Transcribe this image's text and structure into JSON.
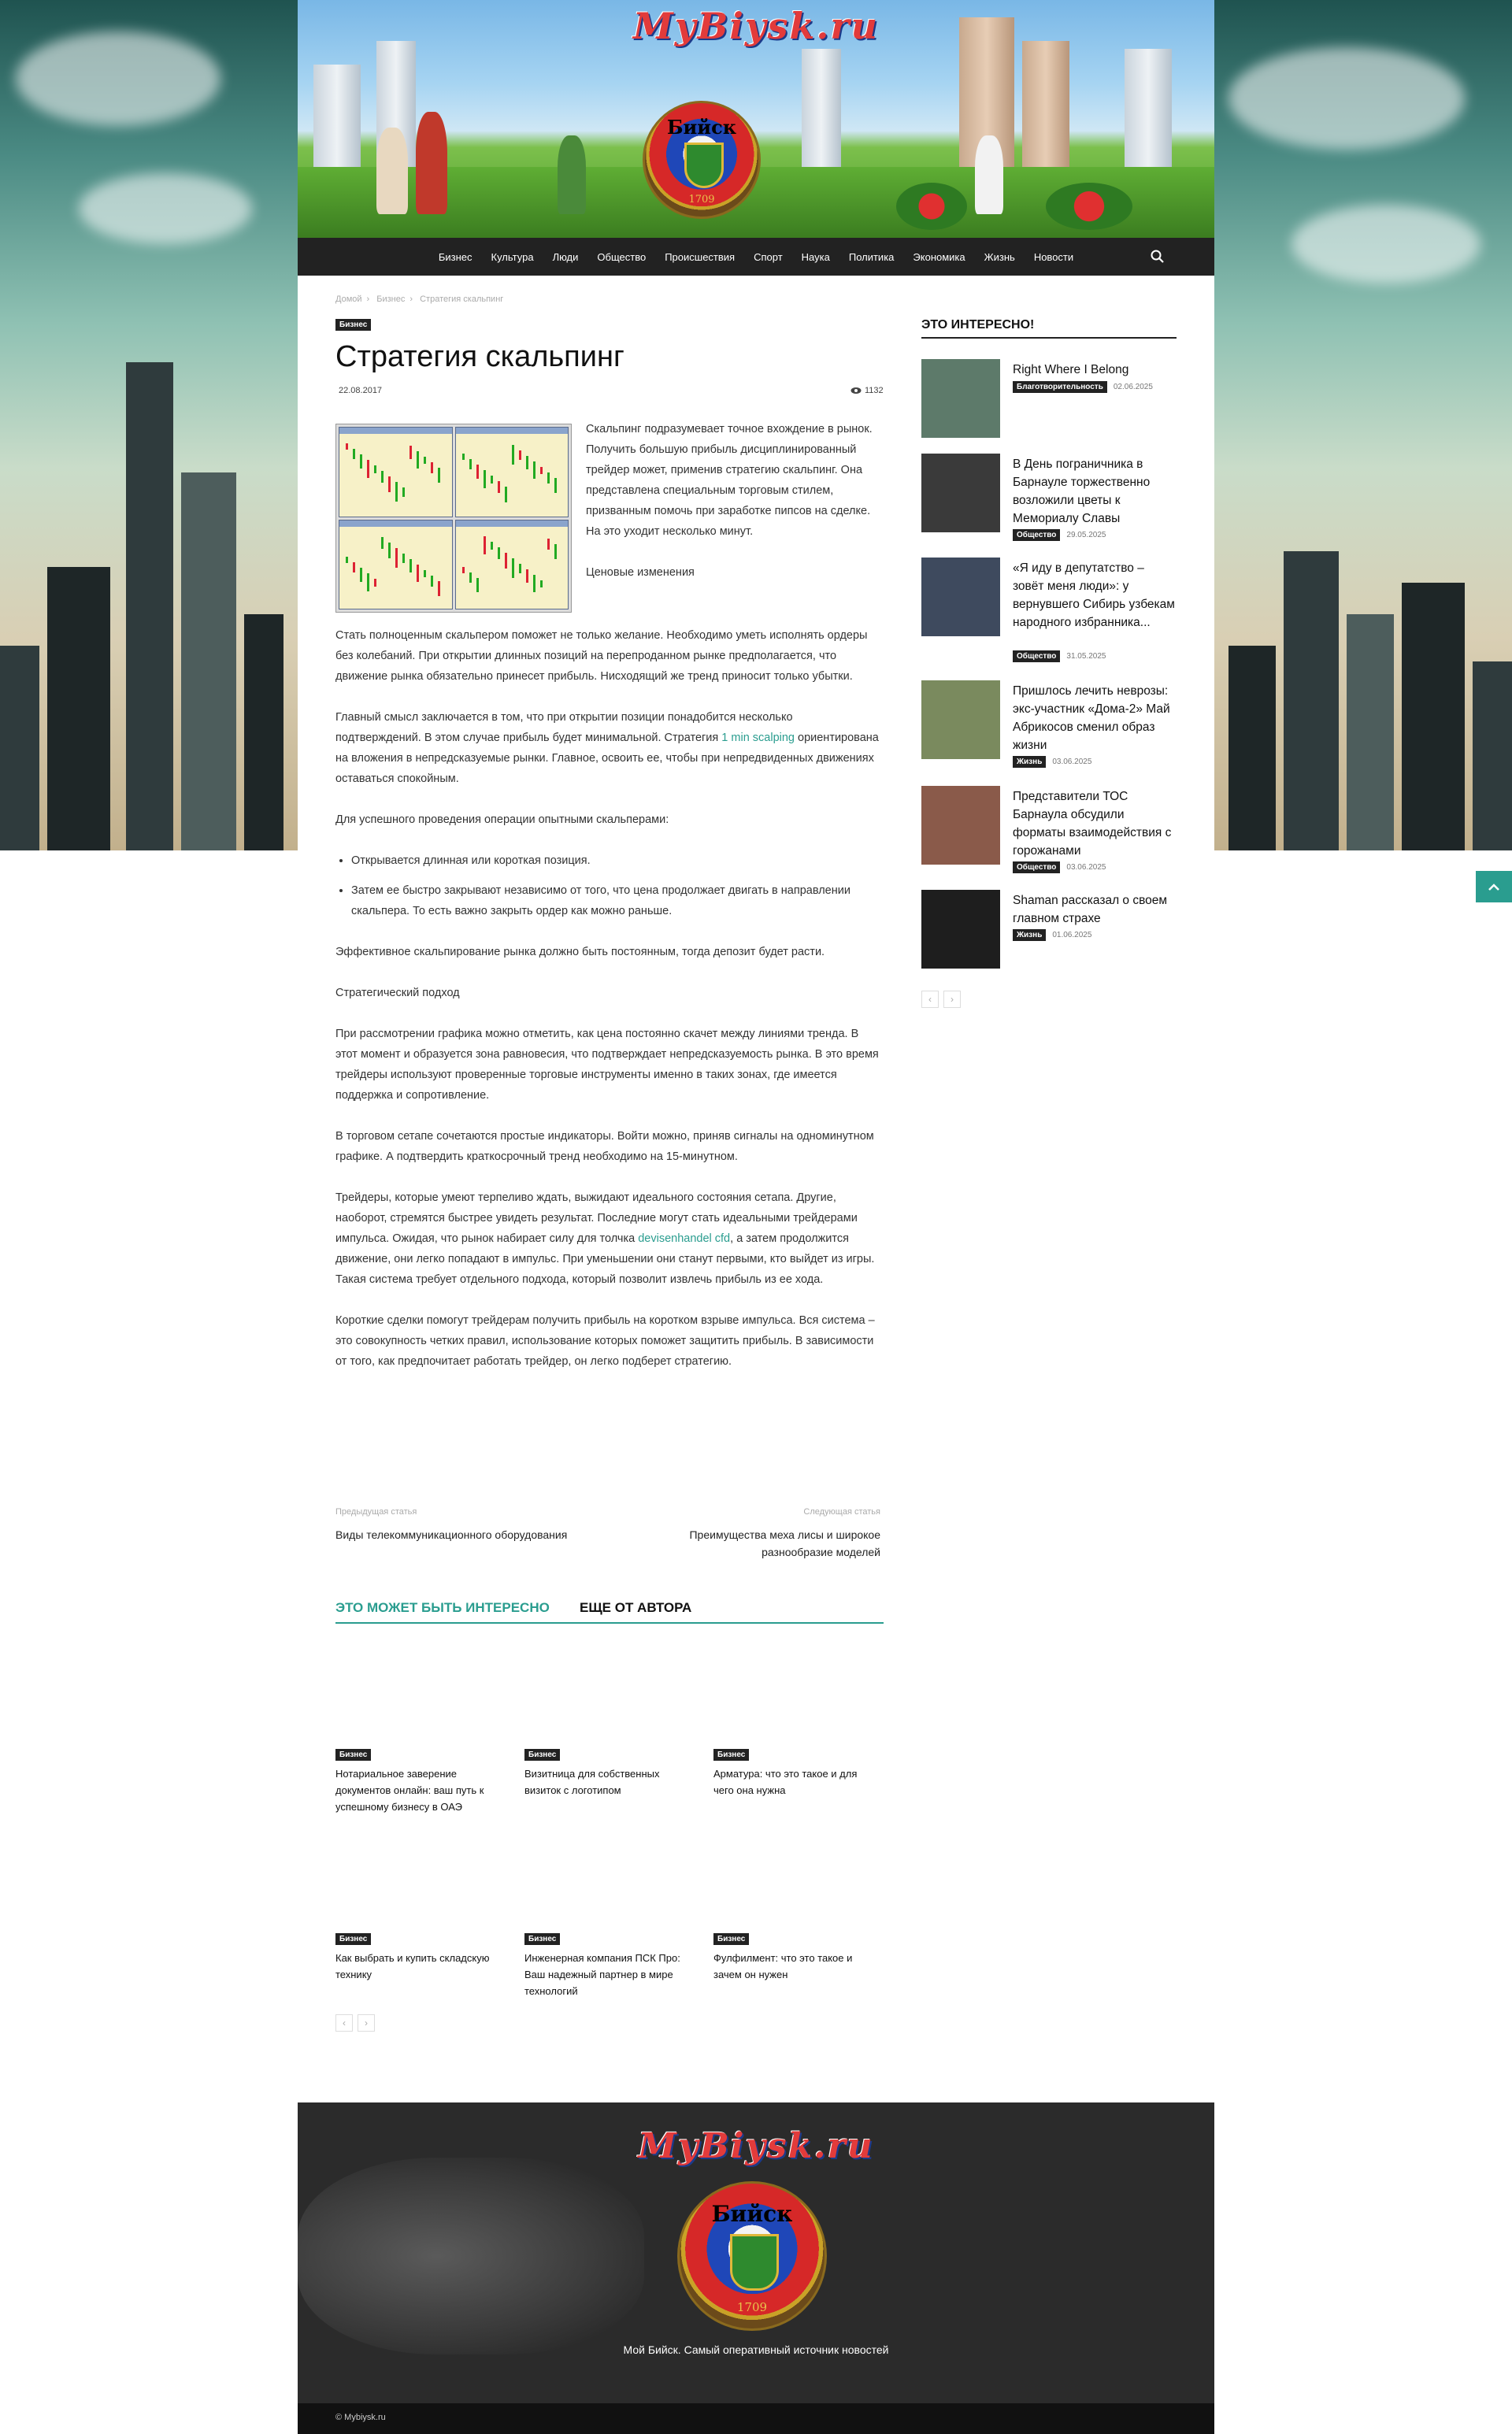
{
  "site": {
    "logo_text": "MyBiysk.ru",
    "emblem_label": "Бийск",
    "emblem_year": "1709"
  },
  "nav": {
    "items": [
      "Бизнес",
      "Культура",
      "Люди",
      "Общество",
      "Происшествия",
      "Спорт",
      "Наука",
      "Политика",
      "Экономика",
      "Жизнь",
      "Новости"
    ]
  },
  "breadcrumb": [
    "Домой",
    "Бизнес",
    "Стратегия скальпинг"
  ],
  "article": {
    "category": "Бизнес",
    "title": "Стратегия скальпинг",
    "date": "22.08.2017",
    "views": "1132",
    "intro": "Скальпинг подразумевает точное вхождение в рынок. Получить большую прибыль дисциплинированный трейдер может, применив стратегию скальпинг. Она представлена специальным торговым стилем, призванным помочь при заработке пипсов на сделке. На это уходит несколько минут.",
    "subhead1": "Ценовые изменения",
    "p1": "Стать полноценным скальпером поможет не только желание. Необходимо уметь исполнять ордеры без колебаний. При открытии длинных позиций на перепроданном рынке предполагается, что движение рынка обязательно принесет прибыль. Нисходящий же тренд приносит только убытки.",
    "p2_before": "Главный смысл заключается в том, что при открытии позиции понадобится несколько подтверждений. В этом случае прибыль будет минимальной. Стратегия ",
    "p2_link": "1 min scalping",
    "p2_after": " ориентирована на вложения в непредсказуемые рынки. Главное, освоить ее, чтобы при непредвиденных движениях оставаться спокойным.",
    "p3": "Для успешного проведения операции опытными скальперами:",
    "list": [
      "Открывается длинная или короткая позиция.",
      "Затем ее быстро закрывают независимо от того, что цена продолжает двигать в направлении скальпера. То есть важно закрыть ордер как можно раньше."
    ],
    "p4": "Эффективное скальпирование рынка должно быть постоянным, тогда депозит будет расти.",
    "subhead2": "Стратегический подход",
    "p5": "При рассмотрении графика можно отметить, как цена постоянно скачет между линиями тренда. В этот момент и образуется зона равновесия, что подтверждает непредсказуемость рынка. В это время трейдеры используют проверенные торговые инструменты именно в таких зонах, где имеется поддержка и сопротивление.",
    "p6": "В торговом сетапе сочетаются простые индикаторы. Войти можно, приняв сигналы на одноминутном графике. А подтвердить краткосрочный тренд необходимо на 15-минутном.",
    "p7_before": "Трейдеры, которые умеют терпеливо ждать, выжидают идеального состояния сетапа. Другие, наоборот, стремятся быстрее увидеть результат. Последние могут стать идеальными трейдерами импульса. Ожидая, что рынок набирает силу для толчка ",
    "p7_link": "devisenhandel cfd",
    "p7_after": ", а затем продолжится движение, они легко попадают в импульс. При уменьшении они станут первыми, кто выйдет из игры. Такая система требует отдельного подхода, который позволит извлечь прибыль из ее хода.",
    "p8": "Короткие сделки помогут трейдерам получить прибыль на коротком взрыве импульса. Вся система – это совокупность четких правил, использование которых поможет защитить прибыль. В зависимости от того, как предпочитает работать трейдер, он легко подберет стратегию."
  },
  "prev_next": {
    "prev_label": "Предыдущая статья",
    "prev_title": "Виды телекоммуникационного оборудования",
    "next_label": "Следующая статья",
    "next_title": "Преимущества меха лисы и широкое разнообразие моделей"
  },
  "related": {
    "tab_active": "ЭТО МОЖЕТ БЫТЬ ИНТЕРЕСНО",
    "tab_other": "ЕЩЕ ОТ АВТОРА",
    "items": [
      {
        "category": "Бизнес",
        "title": "Нотариальное заверение документов онлайн: ваш путь к успешному бизнесу в ОАЭ"
      },
      {
        "category": "Бизнес",
        "title": "Визитница для собственных визиток с логотипом"
      },
      {
        "category": "Бизнес",
        "title": "Арматура: что это такое и для чего она нужна"
      },
      {
        "category": "Бизнес",
        "title": "Как выбрать и купить складскую технику"
      },
      {
        "category": "Бизнес",
        "title": "Инженерная компания ПСК Про: Ваш надежный партнер в мире технологий"
      },
      {
        "category": "Бизнес",
        "title": "Фулфилмент: что это такое и зачем он нужен"
      }
    ]
  },
  "sidebar": {
    "title": "ЭТО ИНТЕРЕСНО!",
    "items": [
      {
        "title": "Right Where I Belong",
        "category": "Благотворительность",
        "date": "02.06.2025",
        "color": "#5d7a6a"
      },
      {
        "title": "В День пограничника в Барнауле торжественно возложили цветы к Мемориалу Славы",
        "category": "Общество",
        "date": "29.05.2025",
        "color": "#3a3a3a"
      },
      {
        "title": "«Я иду в депутатство – зовёт меня люди»: у вернувшего Сибирь узбекам народного избранника...",
        "category": "Общество",
        "date": "31.05.2025",
        "color": "#3e4a5e"
      },
      {
        "title": "Пришлось лечить неврозы: экс-участник «Дома-2» Май Абрикосов сменил образ жизни",
        "category": "Жизнь",
        "date": "03.06.2025",
        "color": "#7a8a5e"
      },
      {
        "title": "Представители ТОС Барнаула обсудили форматы взаимодействия с горожанами",
        "category": "Общество",
        "date": "03.06.2025",
        "color": "#8a5a4a"
      },
      {
        "title": "Shaman рассказал о своем главном страхе",
        "category": "Жизнь",
        "date": "01.06.2025",
        "color": "#1e1e1e"
      }
    ]
  },
  "footer": {
    "logo_text": "MyBiysk.ru",
    "tagline": "Мой Бийск. Самый оперативный источник новостей",
    "copyright": "© Mybiysk.ru"
  }
}
